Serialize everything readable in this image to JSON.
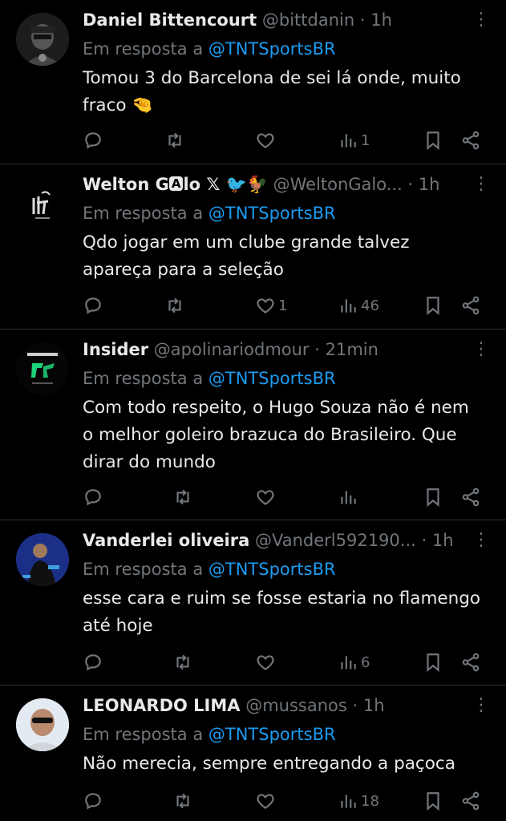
{
  "tweets": [
    {
      "name": "Daniel Bittencourt",
      "handle": "@bittdanin",
      "time": "· 1h",
      "reply_prefix": "Em resposta a",
      "reply_to": "@TNTSportsBR",
      "text": "Tomou 3 do Barcelona de sei lá onde, muito\nfraco 🤏",
      "likes": "",
      "views": "1"
    },
    {
      "name": "Welton G",
      "name_badge": "A",
      "name_suffix": "lo 𝕏 🐦🐓",
      "handle": "@WeltonGalo...",
      "time": "· 1h",
      "reply_prefix": "Em resposta a",
      "reply_to": "@TNTSportsBR",
      "text": "Qdo jogar em um clube grande talvez\napareça para a seleção",
      "likes": "1",
      "views": "46"
    },
    {
      "name": "Insider",
      "handle": "@apolinariodmour",
      "time": "· 21min",
      "reply_prefix": "Em resposta a",
      "reply_to": "@TNTSportsBR",
      "text": "Com todo respeito, o Hugo Souza não é nem\no melhor goleiro brazuca do Brasileiro. Que\ndirar do mundo",
      "likes": "",
      "views": ""
    },
    {
      "name": "Vanderlei oliveira",
      "handle": "@Vanderl592190...",
      "time": "· 1h",
      "reply_prefix": "Em resposta a",
      "reply_to": "@TNTSportsBR",
      "text": "esse cara e ruim se fosse estaria no flamengo\naté hoje",
      "likes": "",
      "views": "6"
    },
    {
      "name": "LEONARDO LIMA",
      "handle": "@mussanos",
      "time": "· 1h",
      "reply_prefix": "Em resposta a",
      "reply_to": "@TNTSportsBR",
      "text": "Não merecia, sempre entregando a paçoca",
      "likes": "",
      "views": "18"
    }
  ],
  "more_glyph": "⋮",
  "colors": {
    "background": "#000000",
    "text": "#e7e9ea",
    "muted": "#71767b",
    "link": "#1d9bf0",
    "divider": "#2f3336"
  }
}
